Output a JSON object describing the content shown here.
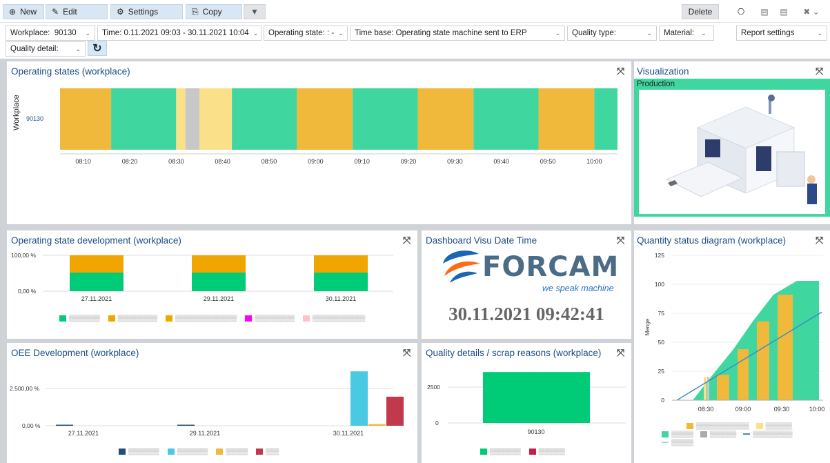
{
  "toolbar": {
    "new": "New",
    "edit": "Edit",
    "settings": "Settings",
    "copy": "Copy",
    "delete": "Delete"
  },
  "filters": {
    "workplace_label": "Workplace:",
    "workplace_value": "90130",
    "time": "Time: 0.11.2021 09:03 - 30.11.2021 10:04",
    "operating_state": "Operating state: : -",
    "time_base": "Time base: Operating state machine sent to ERP",
    "quality_type": "Quality type:",
    "material": "Material:",
    "report_settings": "Report settings",
    "quality_detail": "Quality detail:"
  },
  "panels": {
    "operating_states": "Operating states (workplace)",
    "visualization": "Visualization",
    "visu_state": "Production",
    "state_development": "Operating state development (workplace)",
    "dashboard_visu": "Dashboard Visu Date Time",
    "quantity_status": "Quantity status diagram (workplace)",
    "oee_development": "OEE Development (workplace)",
    "quality_details": "Quality details / scrap reasons (workplace)"
  },
  "forcam": {
    "logo_text": "FORCAM",
    "tagline": "we speak machine",
    "datetime": "30.11.2021 09:42:41"
  },
  "colors": {
    "production": "#3fd69f",
    "quality_green": "#00cc77",
    "waiting": "#f0b93b",
    "yellow_light": "#fbe08a",
    "grey": "#c8c8c8",
    "orange": "#f0a500",
    "magenta": "#ff00ff",
    "pink": "#ffc0cb",
    "navy": "#1f4e79",
    "cyan": "#4ac9e3",
    "red": "#c0394d",
    "crimson": "#c81e45"
  },
  "chart_data": [
    {
      "type": "bar",
      "title": "Operating states (workplace)",
      "ylabel": "Workplace",
      "categories": [
        "90130"
      ],
      "x_ticks": [
        "08:10",
        "08:20",
        "08:30",
        "08:40",
        "08:50",
        "09:00",
        "09:10",
        "09:20",
        "09:30",
        "09:40",
        "09:50",
        "10:00"
      ],
      "segments": [
        {
          "start": "08:05",
          "end": "08:16",
          "state": "waiting"
        },
        {
          "start": "08:16",
          "end": "08:30",
          "state": "production"
        },
        {
          "start": "08:30",
          "end": "08:32",
          "state": "yellow_light"
        },
        {
          "start": "08:32",
          "end": "08:35",
          "state": "grey"
        },
        {
          "start": "08:35",
          "end": "08:42",
          "state": "yellow_light"
        },
        {
          "start": "08:42",
          "end": "08:56",
          "state": "production"
        },
        {
          "start": "08:56",
          "end": "09:08",
          "state": "waiting"
        },
        {
          "start": "09:08",
          "end": "09:22",
          "state": "production"
        },
        {
          "start": "09:22",
          "end": "09:34",
          "state": "waiting"
        },
        {
          "start": "09:34",
          "end": "09:48",
          "state": "production"
        },
        {
          "start": "09:48",
          "end": "10:00",
          "state": "waiting"
        },
        {
          "start": "10:00",
          "end": "10:05",
          "state": "production"
        }
      ]
    },
    {
      "type": "bar",
      "title": "Operating state development (workplace)",
      "categories": [
        "27.11.2021",
        "29.11.2021",
        "30.11.2021"
      ],
      "y_ticks": [
        "100,00 %",
        "0,00 %"
      ],
      "series": [
        {
          "color": "#00cc77",
          "values": [
            52,
            52,
            52
          ]
        },
        {
          "color": "#f0a500",
          "values": [
            48,
            48,
            48
          ]
        }
      ]
    },
    {
      "type": "bar",
      "title": "OEE Development (workplace)",
      "categories": [
        "27.11.2021",
        "29.11.2021",
        "30.11.2021"
      ],
      "y_ticks": [
        "2.500,00 %",
        "0,00 %"
      ],
      "series": [
        {
          "color": "#1f4e79",
          "values": [
            30,
            30,
            0
          ]
        },
        {
          "color": "#4ac9e3",
          "values": [
            0,
            0,
            3650
          ]
        },
        {
          "color": "#f0b93b",
          "values": [
            0,
            0,
            110
          ]
        },
        {
          "color": "#c0394d",
          "values": [
            0,
            0,
            1950
          ]
        }
      ]
    },
    {
      "type": "bar",
      "title": "Quality details / scrap reasons (workplace)",
      "categories": [
        "90130"
      ],
      "y_ticks": [
        "2500",
        "0"
      ],
      "series": [
        {
          "color": "#00cc77",
          "values": [
            3550
          ]
        },
        {
          "color": "#c81e45",
          "values": [
            0
          ]
        }
      ]
    },
    {
      "type": "bar",
      "title": "Quantity status diagram (workplace)",
      "ylabel": "Menge",
      "y_ticks": [
        "125",
        "100",
        "75",
        "50",
        "25",
        "0"
      ],
      "x_ticks": [
        "08:30",
        "09:00",
        "09:30",
        "10:00"
      ],
      "ylim": [
        0,
        125
      ],
      "steps": [
        0,
        0,
        22,
        44,
        68,
        91,
        103
      ]
    }
  ]
}
